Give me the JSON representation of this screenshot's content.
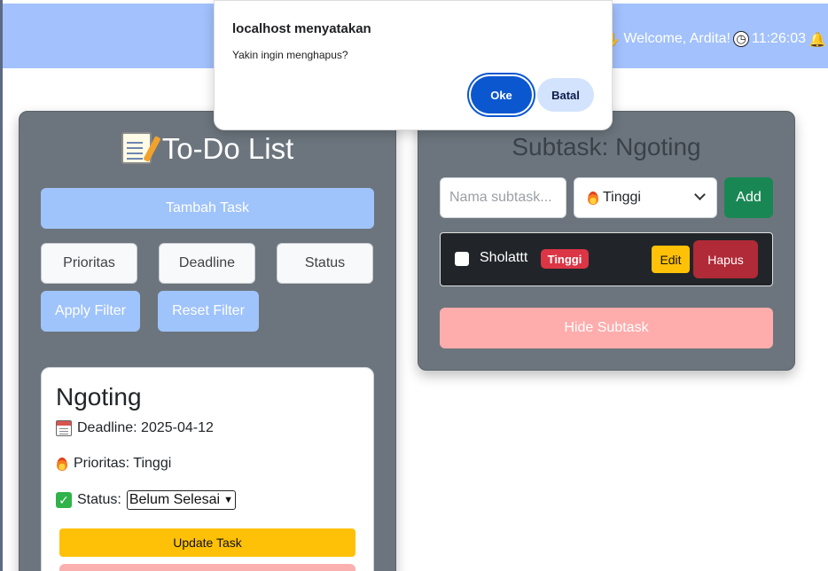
{
  "header": {
    "welcome_text": "Welcome, Ardita!",
    "time": "11:26:03"
  },
  "todo": {
    "title": "To-Do List",
    "add_task_label": "Tambah Task",
    "filters": {
      "priority_label": "Prioritas",
      "deadline_label": "Deadline",
      "status_label": "Status",
      "apply_label": "Apply Filter",
      "reset_label": "Reset Filter"
    },
    "task": {
      "title": "Ngoting",
      "deadline_text": "Deadline: 2025-04-12",
      "priority_text": "Prioritas: Tinggi",
      "status_label": "Status:",
      "status_value": "Belum Selesai",
      "update_label": "Update Task"
    }
  },
  "subtask": {
    "title": "Subtask: Ngoting",
    "input_placeholder": "Nama subtask...",
    "priority_selected": "Tinggi",
    "add_label": "Add",
    "items": [
      {
        "name": "Sholattt",
        "priority": "Tinggi",
        "edit_label": "Edit",
        "delete_label": "Hapus"
      }
    ],
    "hide_label": "Hide Subtask"
  },
  "dialog": {
    "title": "localhost menyatakan",
    "message": "Yakin ingin menghapus?",
    "ok_label": "Oke",
    "cancel_label": "Batal"
  },
  "colors": {
    "topbar": "#a2c1fd",
    "panel": "#6c757d",
    "primary_light": "#9fc3fb",
    "success": "#198754",
    "danger": "#dc3545",
    "warning": "#ffc107",
    "dialog_primary": "#0b57d0"
  }
}
